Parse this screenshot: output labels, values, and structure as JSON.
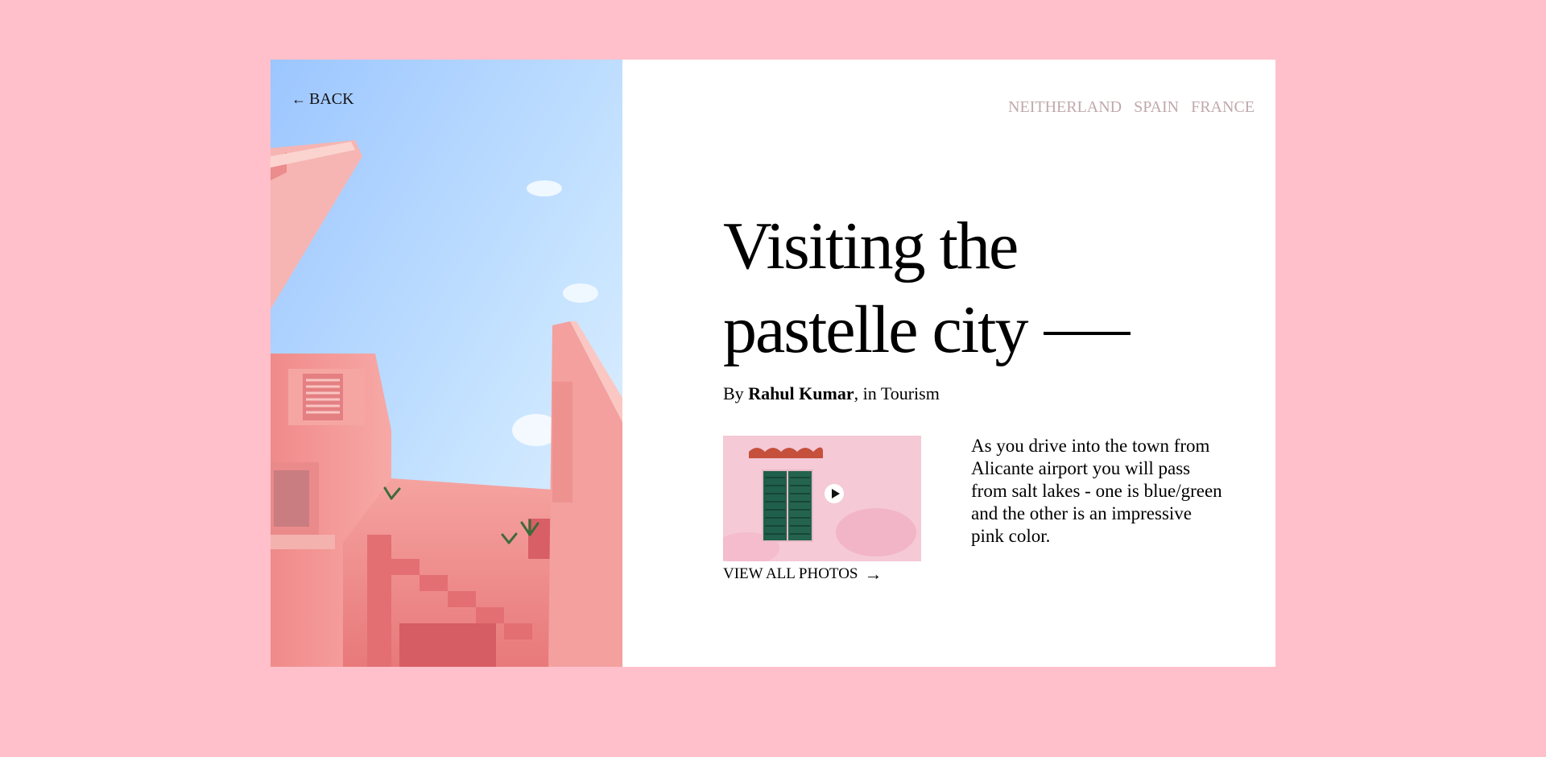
{
  "nav": {
    "back_label": "BACK",
    "countries": [
      "NEITHERLAND",
      "SPAIN",
      "FRANCE"
    ]
  },
  "article": {
    "title_line1": "Visiting the",
    "title_line2": "pastelle city",
    "byline_prefix": "By",
    "author": "Rahul Kumar",
    "byline_suffix": ", in Tourism",
    "description": "As you drive into the town from Alicante airport you will pass from salt lakes - one is blue/green and the other is an impressive pink color."
  },
  "gallery": {
    "view_all_label": "VIEW ALL PHOTOS",
    "play_icon": "play-icon",
    "arrow_icon": "arrow-right-icon"
  },
  "colors": {
    "page_background": "#ffc0cb",
    "card_background": "#ffffff",
    "nav_text": "#c0a8ab",
    "text": "#000000"
  }
}
